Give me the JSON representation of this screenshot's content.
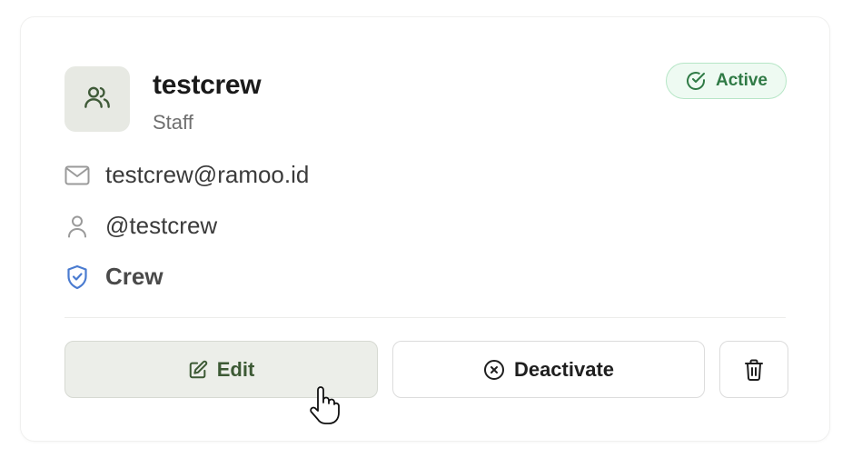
{
  "user": {
    "name": "testcrew",
    "subtitle": "Staff",
    "email": "testcrew@ramoo.id",
    "username": "@testcrew",
    "role": "Crew"
  },
  "status": {
    "label": "Active",
    "color": "#2f7a45"
  },
  "actions": {
    "edit_label": "Edit",
    "deactivate_label": "Deactivate"
  },
  "icons": {
    "avatar": "users-icon",
    "status": "check-circle-icon",
    "email": "mail-icon",
    "username": "user-icon",
    "role": "shield-check-icon",
    "edit": "edit-icon",
    "deactivate": "x-circle-icon",
    "delete": "trash-icon"
  },
  "colors": {
    "accent": "#3d5a35",
    "role_icon": "#4a7bd0"
  }
}
